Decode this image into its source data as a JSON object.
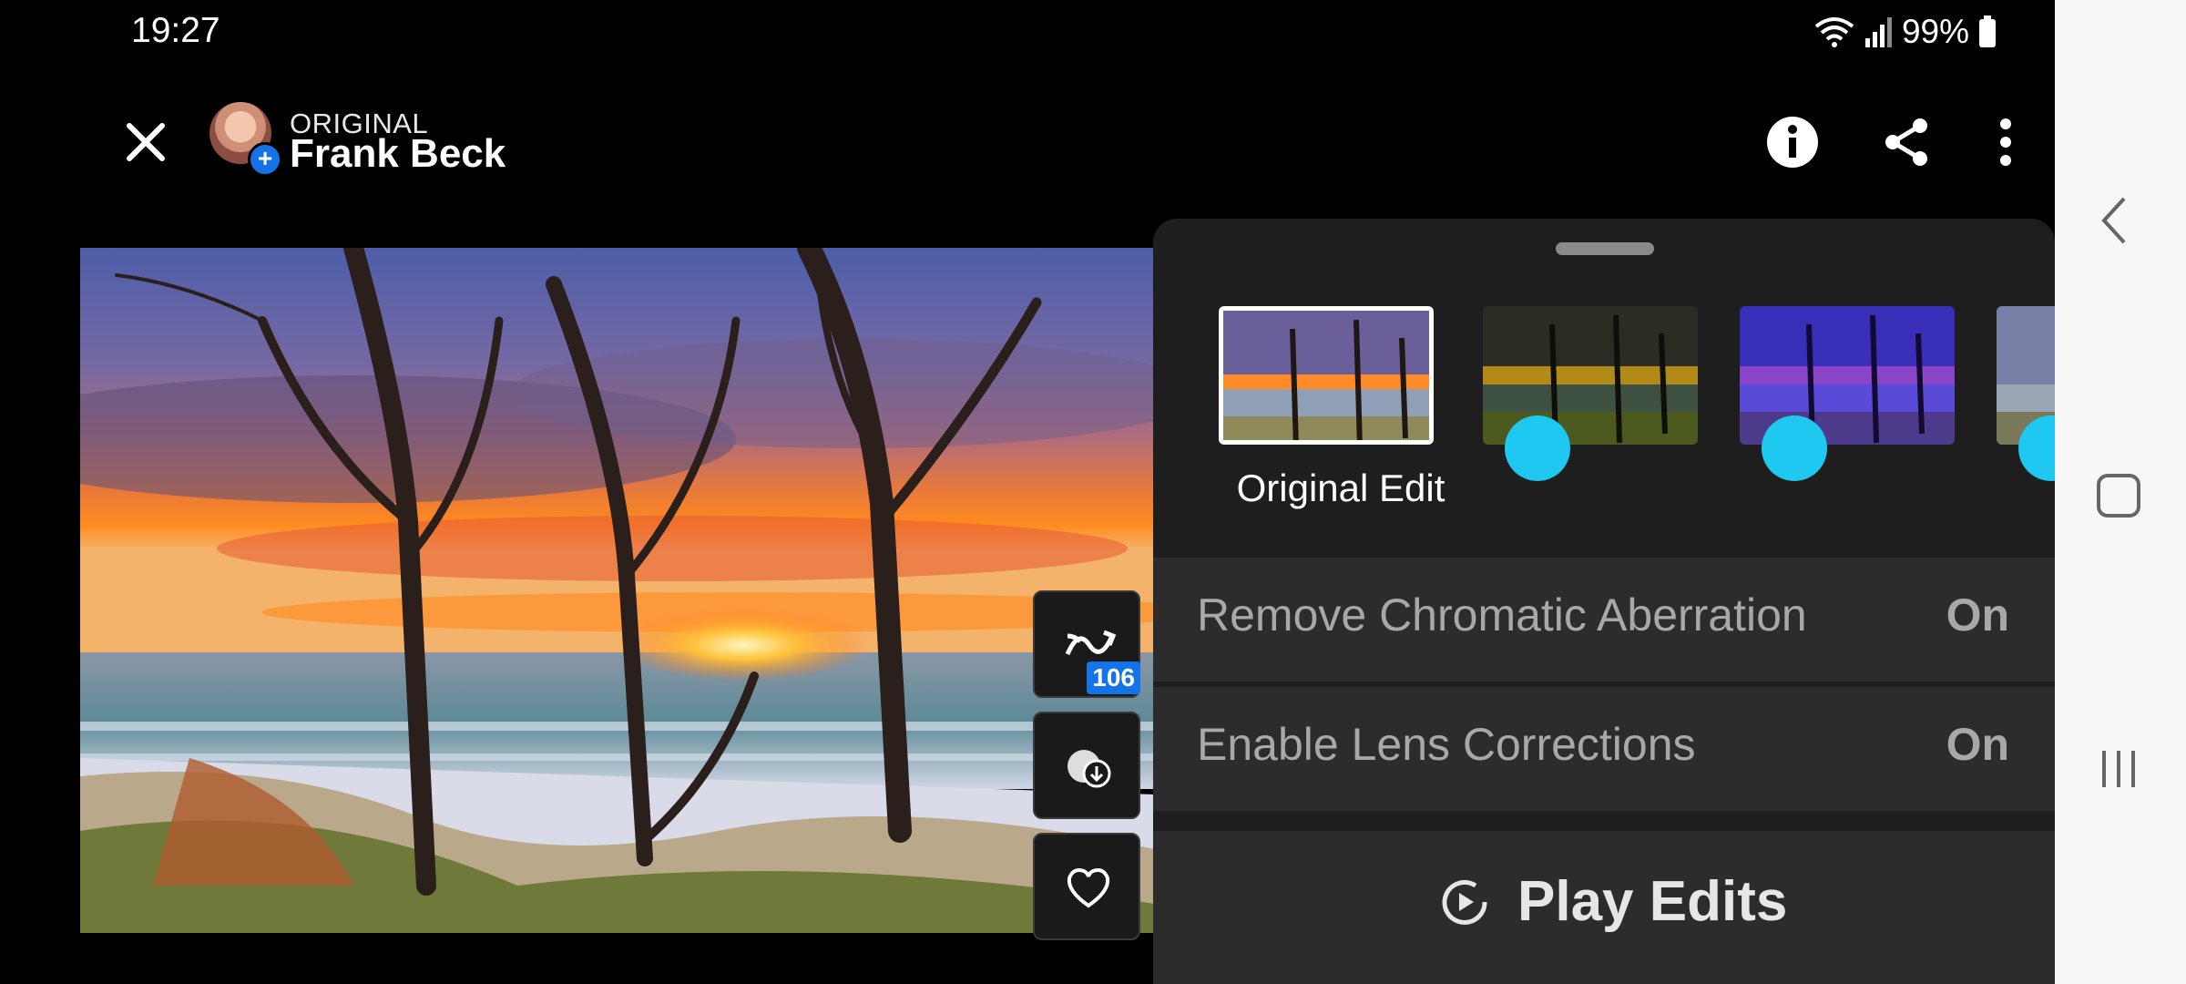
{
  "status_bar": {
    "time": "19:27",
    "battery": "99%"
  },
  "header": {
    "subtitle": "ORIGINAL",
    "owner": "Frank Beck"
  },
  "actions": {
    "remix_count": "106"
  },
  "panel": {
    "versions": [
      {
        "label": "Original Edit"
      }
    ],
    "settings": [
      {
        "label": "Remove Chromatic Aberration",
        "value": "On"
      },
      {
        "label": "Enable Lens Corrections",
        "value": "On"
      }
    ],
    "play_label": "Play Edits"
  },
  "colors": {
    "accent": "#1473e6",
    "edit_marker": "#1ec8f0",
    "panel_bg": "#1e1e1e"
  },
  "icons": [
    "close-icon",
    "info-icon",
    "share-icon",
    "more-vertical-icon",
    "remix-icon",
    "download-icon",
    "heart-icon",
    "play-circle-icon",
    "back-icon",
    "home-icon",
    "recents-icon",
    "wifi-icon",
    "signal-icon",
    "battery-icon"
  ]
}
